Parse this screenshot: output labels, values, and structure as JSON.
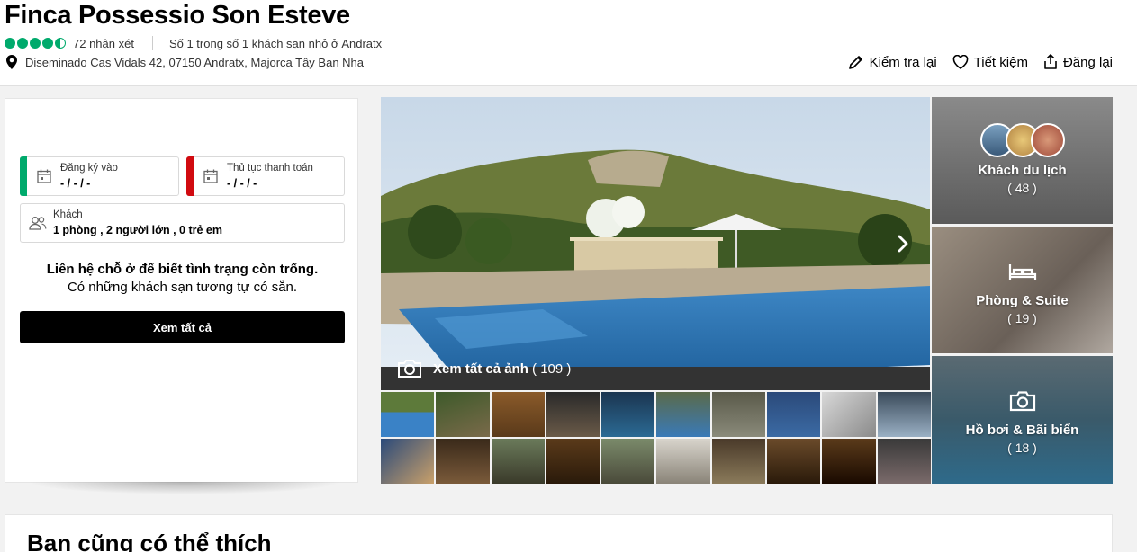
{
  "hotel": {
    "name": "Finca Possessio Son Esteve",
    "rating_value": 4.5,
    "reviews": "72 nhận xét",
    "ranking": "Số 1 trong số 1 khách sạn nhỏ ở Andratx",
    "address": "Diseminado Cas Vidals 42, 07150 Andratx, Majorca Tây Ban Nha"
  },
  "actions": {
    "check": "Kiểm tra lại",
    "save": "Tiết kiệm",
    "share": "Đăng lại"
  },
  "booking": {
    "checkin_label": "Đăng ký vào",
    "checkin_value": "- / - / -",
    "checkout_label": "Thủ tục thanh toán",
    "checkout_value": "- / - / -",
    "guests_label": "Khách",
    "guests_value": "1 phòng , 2 người lớn , 0 trẻ em",
    "availability_line1": "Liên hệ chỗ ở để biết tình trạng còn trống.",
    "availability_line2": "Có những khách sạn tương tự có sẵn.",
    "see_all": "Xem tất cả"
  },
  "gallery": {
    "see_all_photos": "Xem tất cả ảnh",
    "see_all_count": "( 109 )",
    "tiles": [
      {
        "name": "Khách du lịch",
        "count": "( 48 )"
      },
      {
        "name": "Phòng & Suite",
        "count": "( 19 )"
      },
      {
        "name": "Hồ bơi & Bãi biển",
        "count": "( 18 )"
      }
    ]
  },
  "colors": {
    "rating_green": "#00aa6c",
    "checkin_bar": "#00aa6c",
    "checkout_bar": "#d10a10",
    "button_black": "#000000"
  },
  "section": {
    "also_like": "Bạn cũng có thể thích"
  }
}
